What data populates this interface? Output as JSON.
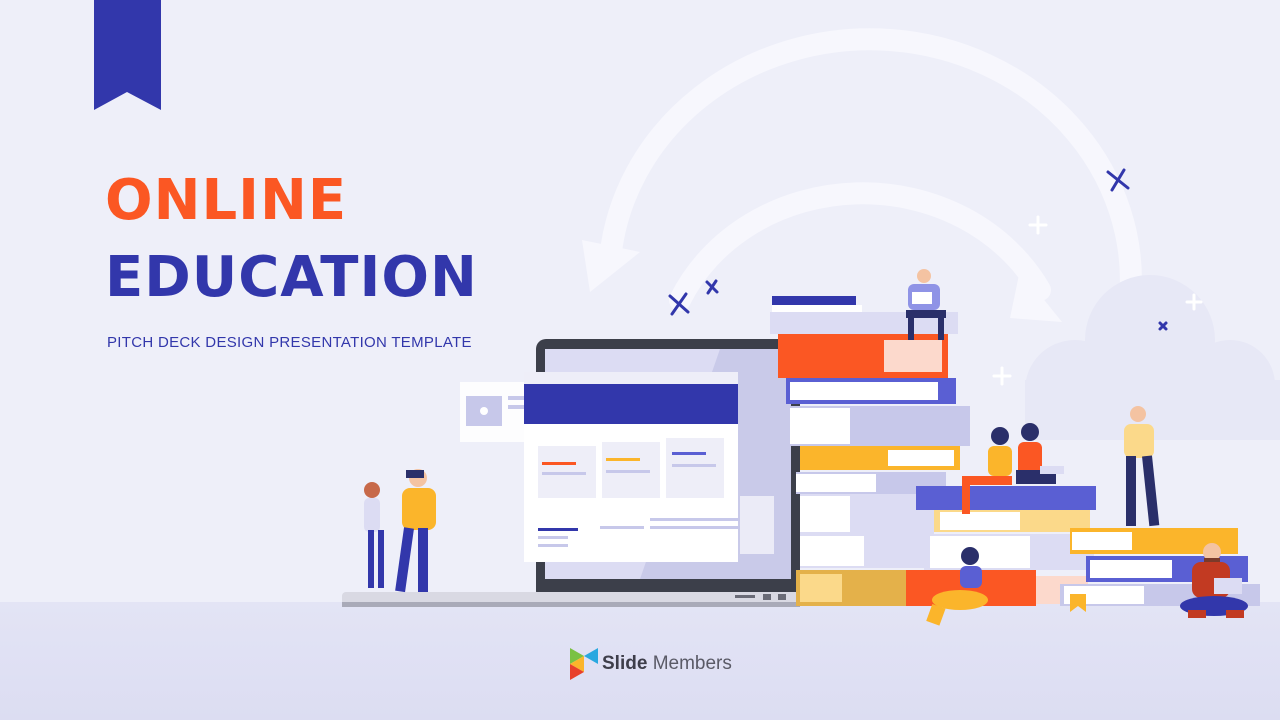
{
  "slide": {
    "title_line1": "ONLINE",
    "title_line2": "EDUCATION",
    "subtitle": "PITCH DECK DESIGN PRESENTATION TEMPLATE"
  },
  "brand": {
    "name_bold": "Slide",
    "name_regular": "Members",
    "logo_icon": "triangle-logo-icon"
  },
  "colors": {
    "background": "#eeeff9",
    "accent_orange": "#fb5723",
    "accent_blue": "#3237ab",
    "accent_yellow": "#fbb52b"
  }
}
